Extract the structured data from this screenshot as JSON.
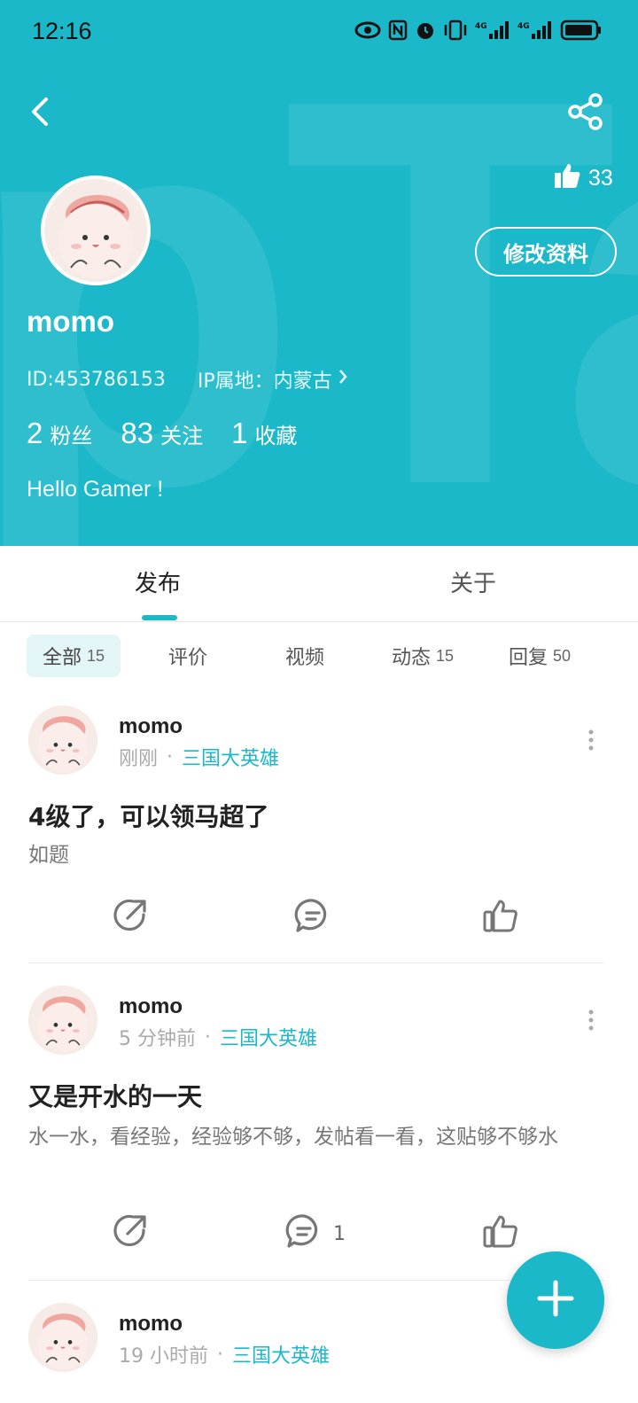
{
  "status_bar": {
    "time": "12:16"
  },
  "profile": {
    "likes": "33",
    "edit_label": "修改资料",
    "username": "momo",
    "id_text": "ID:453786153",
    "ip_text": "IP属地：内蒙古",
    "stats": [
      {
        "num": "2",
        "label": "粉丝"
      },
      {
        "num": "83",
        "label": "关注"
      },
      {
        "num": "1",
        "label": "收藏"
      }
    ],
    "bio": "Hello Gamer !"
  },
  "tabs": [
    {
      "label": "发布"
    },
    {
      "label": "关于"
    }
  ],
  "filters": [
    {
      "label": "全部",
      "count": "15"
    },
    {
      "label": "评价",
      "count": ""
    },
    {
      "label": "视频",
      "count": ""
    },
    {
      "label": "动态",
      "count": "15"
    },
    {
      "label": "回复",
      "count": "50"
    }
  ],
  "posts": [
    {
      "user": "momo",
      "time": "刚刚",
      "game": "三国大英雄",
      "title": "4级了，可以领马超了",
      "body": "如题",
      "comments": ""
    },
    {
      "user": "momo",
      "time": "5 分钟前",
      "game": "三国大英雄",
      "title": "又是开水的一天",
      "body": "水一水，看经验，经验够不够，发帖看一看，这贴够不够水",
      "comments": "1"
    },
    {
      "user": "momo",
      "time": "19 小时前",
      "game": "三国大英雄",
      "title": "",
      "body": "",
      "comments": ""
    }
  ],
  "colors": {
    "accent": "#1ab8c8",
    "header_bg": "#1ab8c8"
  },
  "icons": [
    "back-icon",
    "share-icon",
    "thumbs-up-icon",
    "repost-icon",
    "comment-icon",
    "like-icon",
    "more-icon",
    "plus-icon"
  ]
}
